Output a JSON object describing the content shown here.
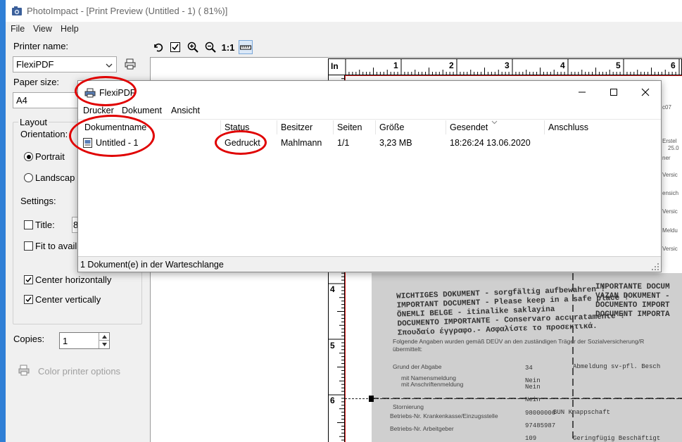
{
  "window": {
    "title": "PhotoImpact - [Print Preview (Untitled - 1)  ( 81%)]"
  },
  "menubar": {
    "items": [
      "File",
      "View",
      "Help"
    ]
  },
  "left_panel": {
    "printer_name_label": "Printer name:",
    "printer_name_value": "FlexiPDF",
    "paper_size_label": "Paper size:",
    "paper_size_value": "A4",
    "layout_group_label": "Layout",
    "orientation_label": "Orientation:",
    "portrait_label": "Portrait",
    "landscape_label": "Landscap",
    "settings_label": "Settings:",
    "title_label": "Title:",
    "title_value": "8",
    "fit_label": "Fit to avail",
    "center_h_label": "Center horizontally",
    "center_v_label": "Center vertically",
    "copies_label": "Copies:",
    "copies_value": "1",
    "color_options_label": "Color printer options"
  },
  "ruler": {
    "unit": "In",
    "top_numbers": [
      "1",
      "2",
      "3",
      "4",
      "5",
      "6"
    ],
    "left_numbers": [
      "4",
      "5",
      "6"
    ]
  },
  "dialog": {
    "title": "FlexiPDF",
    "menu": [
      "Drucker",
      "Dokument",
      "Ansicht"
    ],
    "columns": [
      "Dokumentname",
      "Status",
      "Besitzer",
      "Seiten",
      "Größe",
      "Gesendet",
      "Anschluss"
    ],
    "row": {
      "name": "Untitled - 1",
      "status": "Gedruckt",
      "owner": "Mahlmann",
      "pages": "1/1",
      "size": "3,23 MB",
      "sent": "18:26:24  13.06.2020",
      "port": ""
    },
    "statusbar": "1 Dokument(e) in der Warteschlange"
  },
  "document_preview": {
    "lines": [
      "WICHTIGES DOKUMENT - sorgfältig aufbewahren !",
      "IMPORTANT DOCUMENT - Please keep in a safe place !",
      "ÖNEMLI BELGE - itinalike saklayina",
      "DOCUMENTO IMPORTANTE - Conservaro accuratamente !",
      "Σπουδαίο έγγραφο.- Ασφαλίστε το προσεκτικά."
    ],
    "right_lines": [
      "IMPORTANTE DOCUM",
      "VAZAN DOKUMENT -",
      "DOCUMENTO IMPORT",
      "DOCUMENT IMPORTA"
    ],
    "body_lines": [
      "Folgende Angaben wurden gemäß DEÜV an den zuständigen Träger der Sozialversicherung/R",
      "übermittelt:",
      "Grund der Abgabe",
      "mit Namensmeldung",
      "mit Anschriftenmeldung",
      "Stornierung",
      "Betriebs-Nr. Krankenkasse/Einzugsstelle",
      "Betriebs-Nr. Arbeitgeber"
    ],
    "values": [
      "34",
      "Nein",
      "Nein",
      "Nein",
      "98000006",
      "97485987",
      "109"
    ],
    "value_labels": [
      "Abmeldung sv-pfl. Besch",
      "BUN Knappschaft",
      "Geringfügig Beschäftigt"
    ],
    "side_snippets": [
      "c07",
      "Erstel",
      "25.0",
      "ner",
      "Versic",
      "ensich",
      "Versic",
      "Meldu",
      "Versic"
    ]
  }
}
